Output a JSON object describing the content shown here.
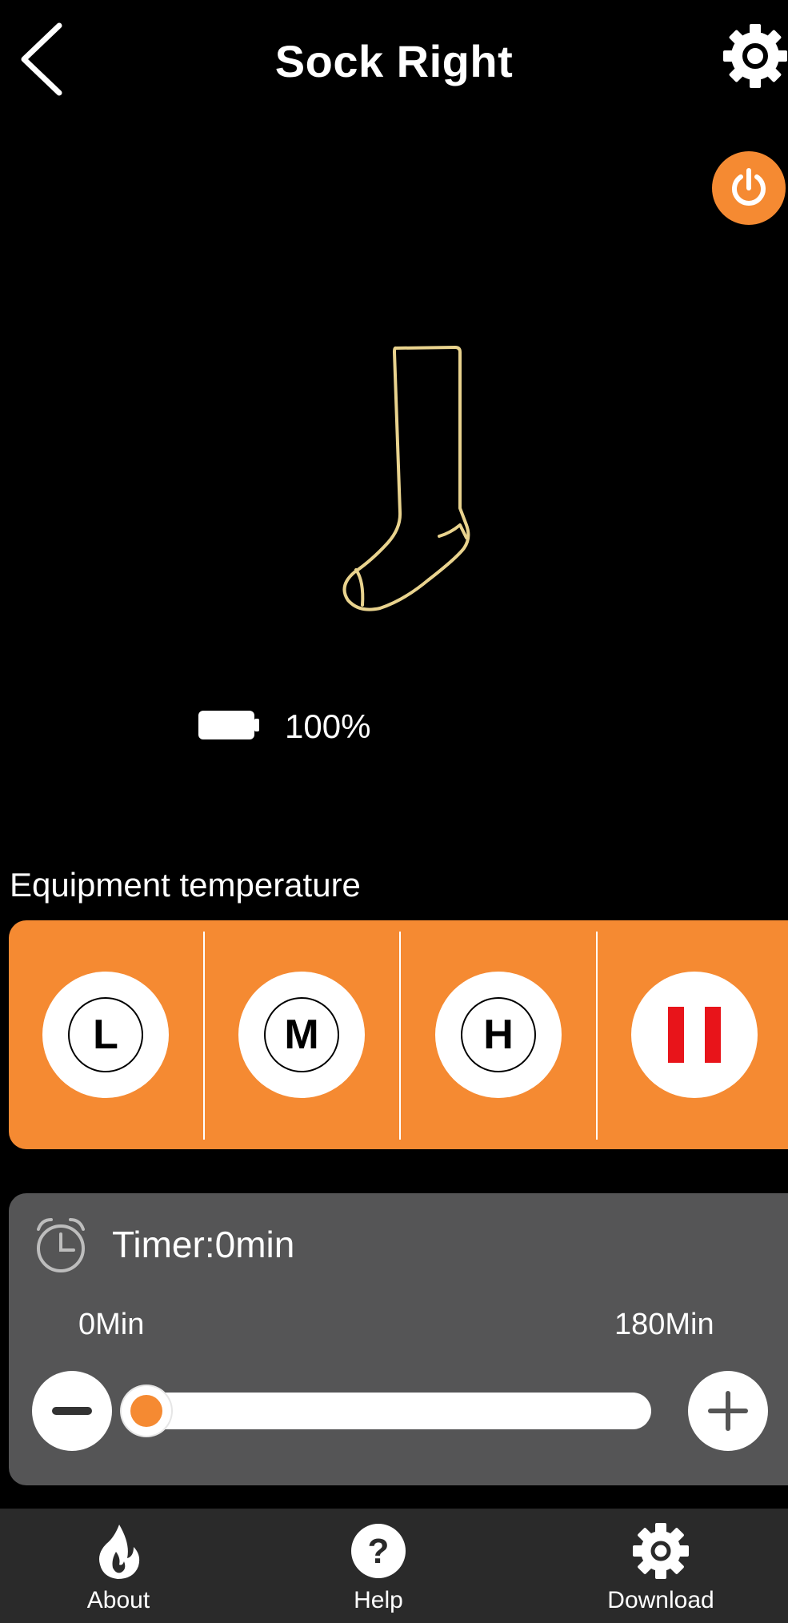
{
  "header": {
    "title": "Sock Right",
    "back_icon": "chevron-left-icon",
    "settings_icon": "gear-icon"
  },
  "power": {
    "icon": "power-icon",
    "color": "#f58a32"
  },
  "device": {
    "image": "sock-outline",
    "battery_percent": "100%"
  },
  "temperature": {
    "label": "Equipment temperature",
    "levels": [
      {
        "label": "L"
      },
      {
        "label": "M"
      },
      {
        "label": "H"
      },
      {
        "label": "pause",
        "icon": "pause-icon",
        "color": "#e8141a"
      }
    ],
    "panel_color": "#f58a32"
  },
  "timer": {
    "icon": "alarm-clock-icon",
    "text": "Timer:0min",
    "min_label": "0Min",
    "max_label": "180Min",
    "value_minutes": 0,
    "max_minutes": 180,
    "panel_color": "#555556"
  },
  "nav": {
    "items": [
      {
        "label": "About",
        "icon": "flame-icon"
      },
      {
        "label": "Help",
        "icon": "question-icon"
      },
      {
        "label": "Download",
        "icon": "gear-icon"
      }
    ]
  }
}
